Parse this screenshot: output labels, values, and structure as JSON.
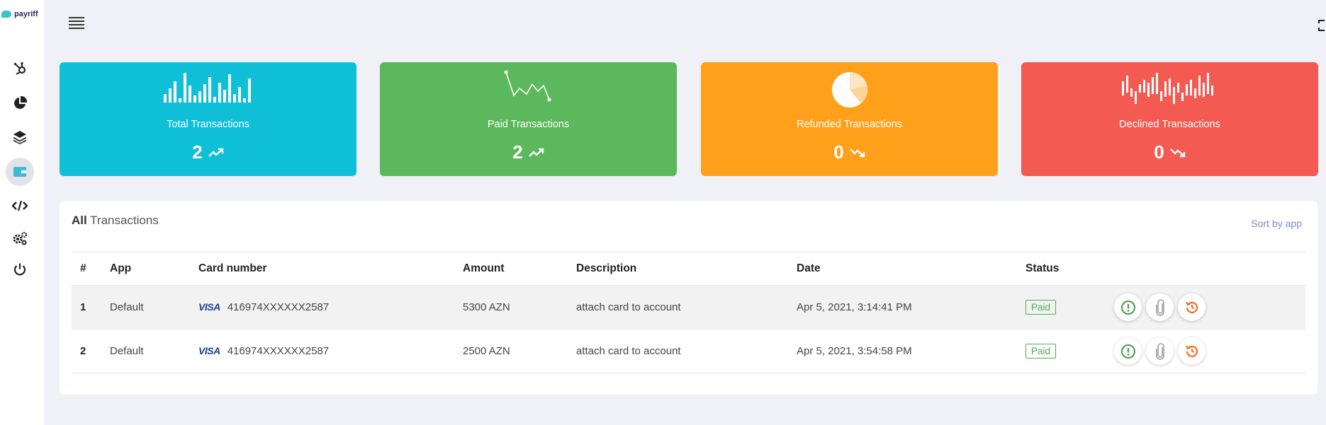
{
  "brand": {
    "name": "payriff",
    "color": "#36c3d8"
  },
  "sidebar": {
    "items": [
      {
        "icon": "hubspot-icon"
      },
      {
        "icon": "pie-chart-icon"
      },
      {
        "icon": "layers-icon"
      },
      {
        "icon": "wallet-icon",
        "active": true
      },
      {
        "icon": "code-icon"
      },
      {
        "icon": "settings-gears-icon"
      },
      {
        "icon": "power-icon"
      }
    ]
  },
  "cards": [
    {
      "title": "Total Transactions",
      "value": "2",
      "trend": "up",
      "color": "#0fbfd8"
    },
    {
      "title": "Paid Transactions",
      "value": "2",
      "trend": "up",
      "color": "#5cb85c"
    },
    {
      "title": "Refunded Transactions",
      "value": "0",
      "trend": "down",
      "color": "#ffa01b"
    },
    {
      "title": "Declined Transactions",
      "value": "0",
      "trend": "down",
      "color": "#f35a51"
    }
  ],
  "panel": {
    "title_bold": "All",
    "title_rest": " Transactions",
    "sort_label": "Sort by app"
  },
  "table": {
    "columns": [
      "#",
      "App",
      "Card number",
      "Amount",
      "Description",
      "Date",
      "Status"
    ],
    "rows": [
      {
        "num": "1",
        "app": "Default",
        "card_brand": "VISA",
        "card": "416974XXXXXX2587",
        "amount": "5300 AZN",
        "description": "attach card to account",
        "date": "Apr 5, 2021, 3:14:41 PM",
        "status": "Paid"
      },
      {
        "num": "2",
        "app": "Default",
        "card_brand": "VISA",
        "card": "416974XXXXXX2587",
        "amount": "2500 AZN",
        "description": "attach card to account",
        "date": "Apr 5, 2021, 3:54:58 PM",
        "status": "Paid"
      }
    ]
  }
}
